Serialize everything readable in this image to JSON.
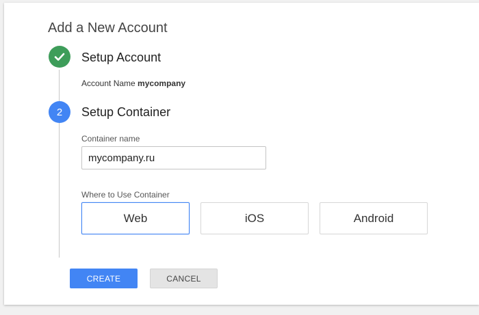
{
  "page": {
    "title": "Add a New Account"
  },
  "steps": [
    {
      "number": "",
      "title": "Setup Account",
      "status": "complete"
    },
    {
      "number": "2",
      "title": "Setup Container",
      "status": "active"
    }
  ],
  "account": {
    "label": "Account Name",
    "value": "mycompany"
  },
  "container": {
    "name_label": "Container name",
    "name_value": "mycompany.ru",
    "where_label": "Where to Use Container",
    "options": [
      "Web",
      "iOS",
      "Android"
    ],
    "selected": "Web"
  },
  "actions": {
    "create_label": "CREATE",
    "cancel_label": "CANCEL"
  },
  "colors": {
    "complete": "#3e9d5a",
    "active": "#4285f4",
    "primary_button": "#4285f4",
    "secondary_button": "#e4e4e4"
  },
  "icons": {
    "step_complete": "check-icon"
  }
}
